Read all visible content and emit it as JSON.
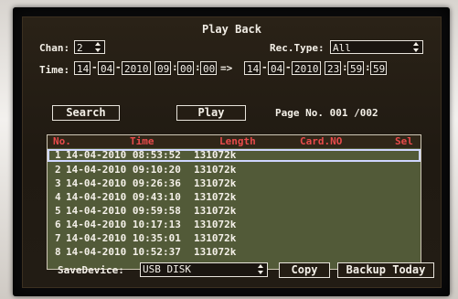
{
  "header": {
    "title": "Play Back"
  },
  "filters": {
    "chan_label": "Chan:",
    "chan_value": "2",
    "rec_type_label": "Rec.Type:",
    "rec_type_value": "All",
    "time_label": "Time:",
    "start": {
      "day": "14",
      "month": "04",
      "year": "2010",
      "hour": "09",
      "minute": "00",
      "second": "00"
    },
    "arrow": "=>",
    "end": {
      "day": "14",
      "month": "04",
      "year": "2010",
      "hour": "23",
      "minute": "59",
      "second": "59"
    }
  },
  "actions": {
    "search_label": "Search",
    "play_label": "Play",
    "page_label": "Page No. 001 /002"
  },
  "table": {
    "columns": [
      "No.",
      "Time",
      "Length",
      "Card.NO",
      "Sel"
    ],
    "rows": [
      {
        "no": "1",
        "time": "14-04-2010 08:53:52",
        "length": "131072k"
      },
      {
        "no": "2",
        "time": "14-04-2010 09:10:20",
        "length": "131072k"
      },
      {
        "no": "3",
        "time": "14-04-2010 09:26:36",
        "length": "131072k"
      },
      {
        "no": "4",
        "time": "14-04-2010 09:43:10",
        "length": "131072k"
      },
      {
        "no": "5",
        "time": "14-04-2010 09:59:58",
        "length": "131072k"
      },
      {
        "no": "6",
        "time": "14-04-2010 10:17:13",
        "length": "131072k"
      },
      {
        "no": "7",
        "time": "14-04-2010 10:35:01",
        "length": "131072k"
      },
      {
        "no": "8",
        "time": "14-04-2010 10:52:37",
        "length": "131072k"
      }
    ]
  },
  "footer": {
    "save_device_label": "SaveDevice:",
    "save_device_value": "USB DISK",
    "copy_label": "Copy",
    "backup_today_label": "Backup Today"
  },
  "colors": {
    "header_text": "#e84b4b",
    "table_bg": "#525a38",
    "selection_outline": "#cfd6ff"
  }
}
